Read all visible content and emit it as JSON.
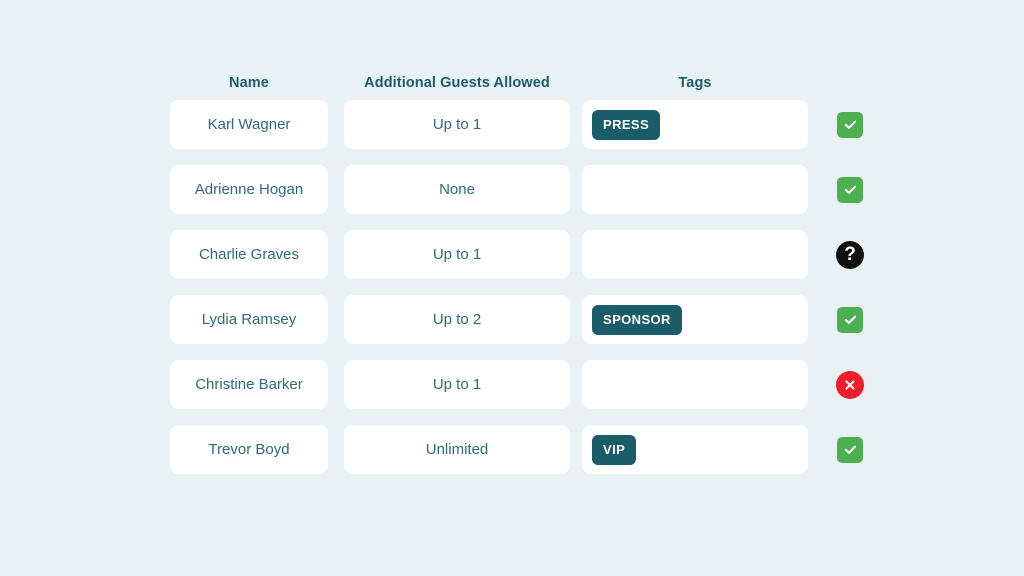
{
  "table": {
    "columns": [
      {
        "key": "name",
        "label": "Name"
      },
      {
        "key": "guests",
        "label": "Additional Guests Allowed"
      },
      {
        "key": "tags",
        "label": "Tags"
      }
    ],
    "rows": [
      {
        "name": "Karl Wagner",
        "guests": "Up to 1",
        "tag": "PRESS",
        "status": "check",
        "status_label": "Confirmed"
      },
      {
        "name": "Adrienne Hogan",
        "guests": "None",
        "tag": "",
        "status": "check",
        "status_label": "Confirmed"
      },
      {
        "name": "Charlie Graves",
        "guests": "Up to 1",
        "tag": "",
        "status": "question",
        "status_label": "Unknown"
      },
      {
        "name": "Lydia Ramsey",
        "guests": "Up to 2",
        "tag": "SPONSOR",
        "status": "check",
        "status_label": "Confirmed"
      },
      {
        "name": "Christine Barker",
        "guests": "Up to 1",
        "tag": "",
        "status": "cross",
        "status_label": "Declined"
      },
      {
        "name": "Trevor Boyd",
        "guests": "Unlimited",
        "tag": "VIP",
        "status": "check",
        "status_label": "Confirmed"
      }
    ]
  },
  "colors": {
    "background": "#e8f1f3",
    "card": "#ffffff",
    "header_text": "#1d5c6b",
    "cell_text": "#2d6b78",
    "tag_pill": "#1a5c68",
    "status_check": "#4caf50",
    "status_question": "#111111",
    "status_cross": "#f01e2c"
  },
  "icons": {
    "check": "check-icon",
    "question": "question-mark-icon",
    "cross": "cross-icon"
  }
}
